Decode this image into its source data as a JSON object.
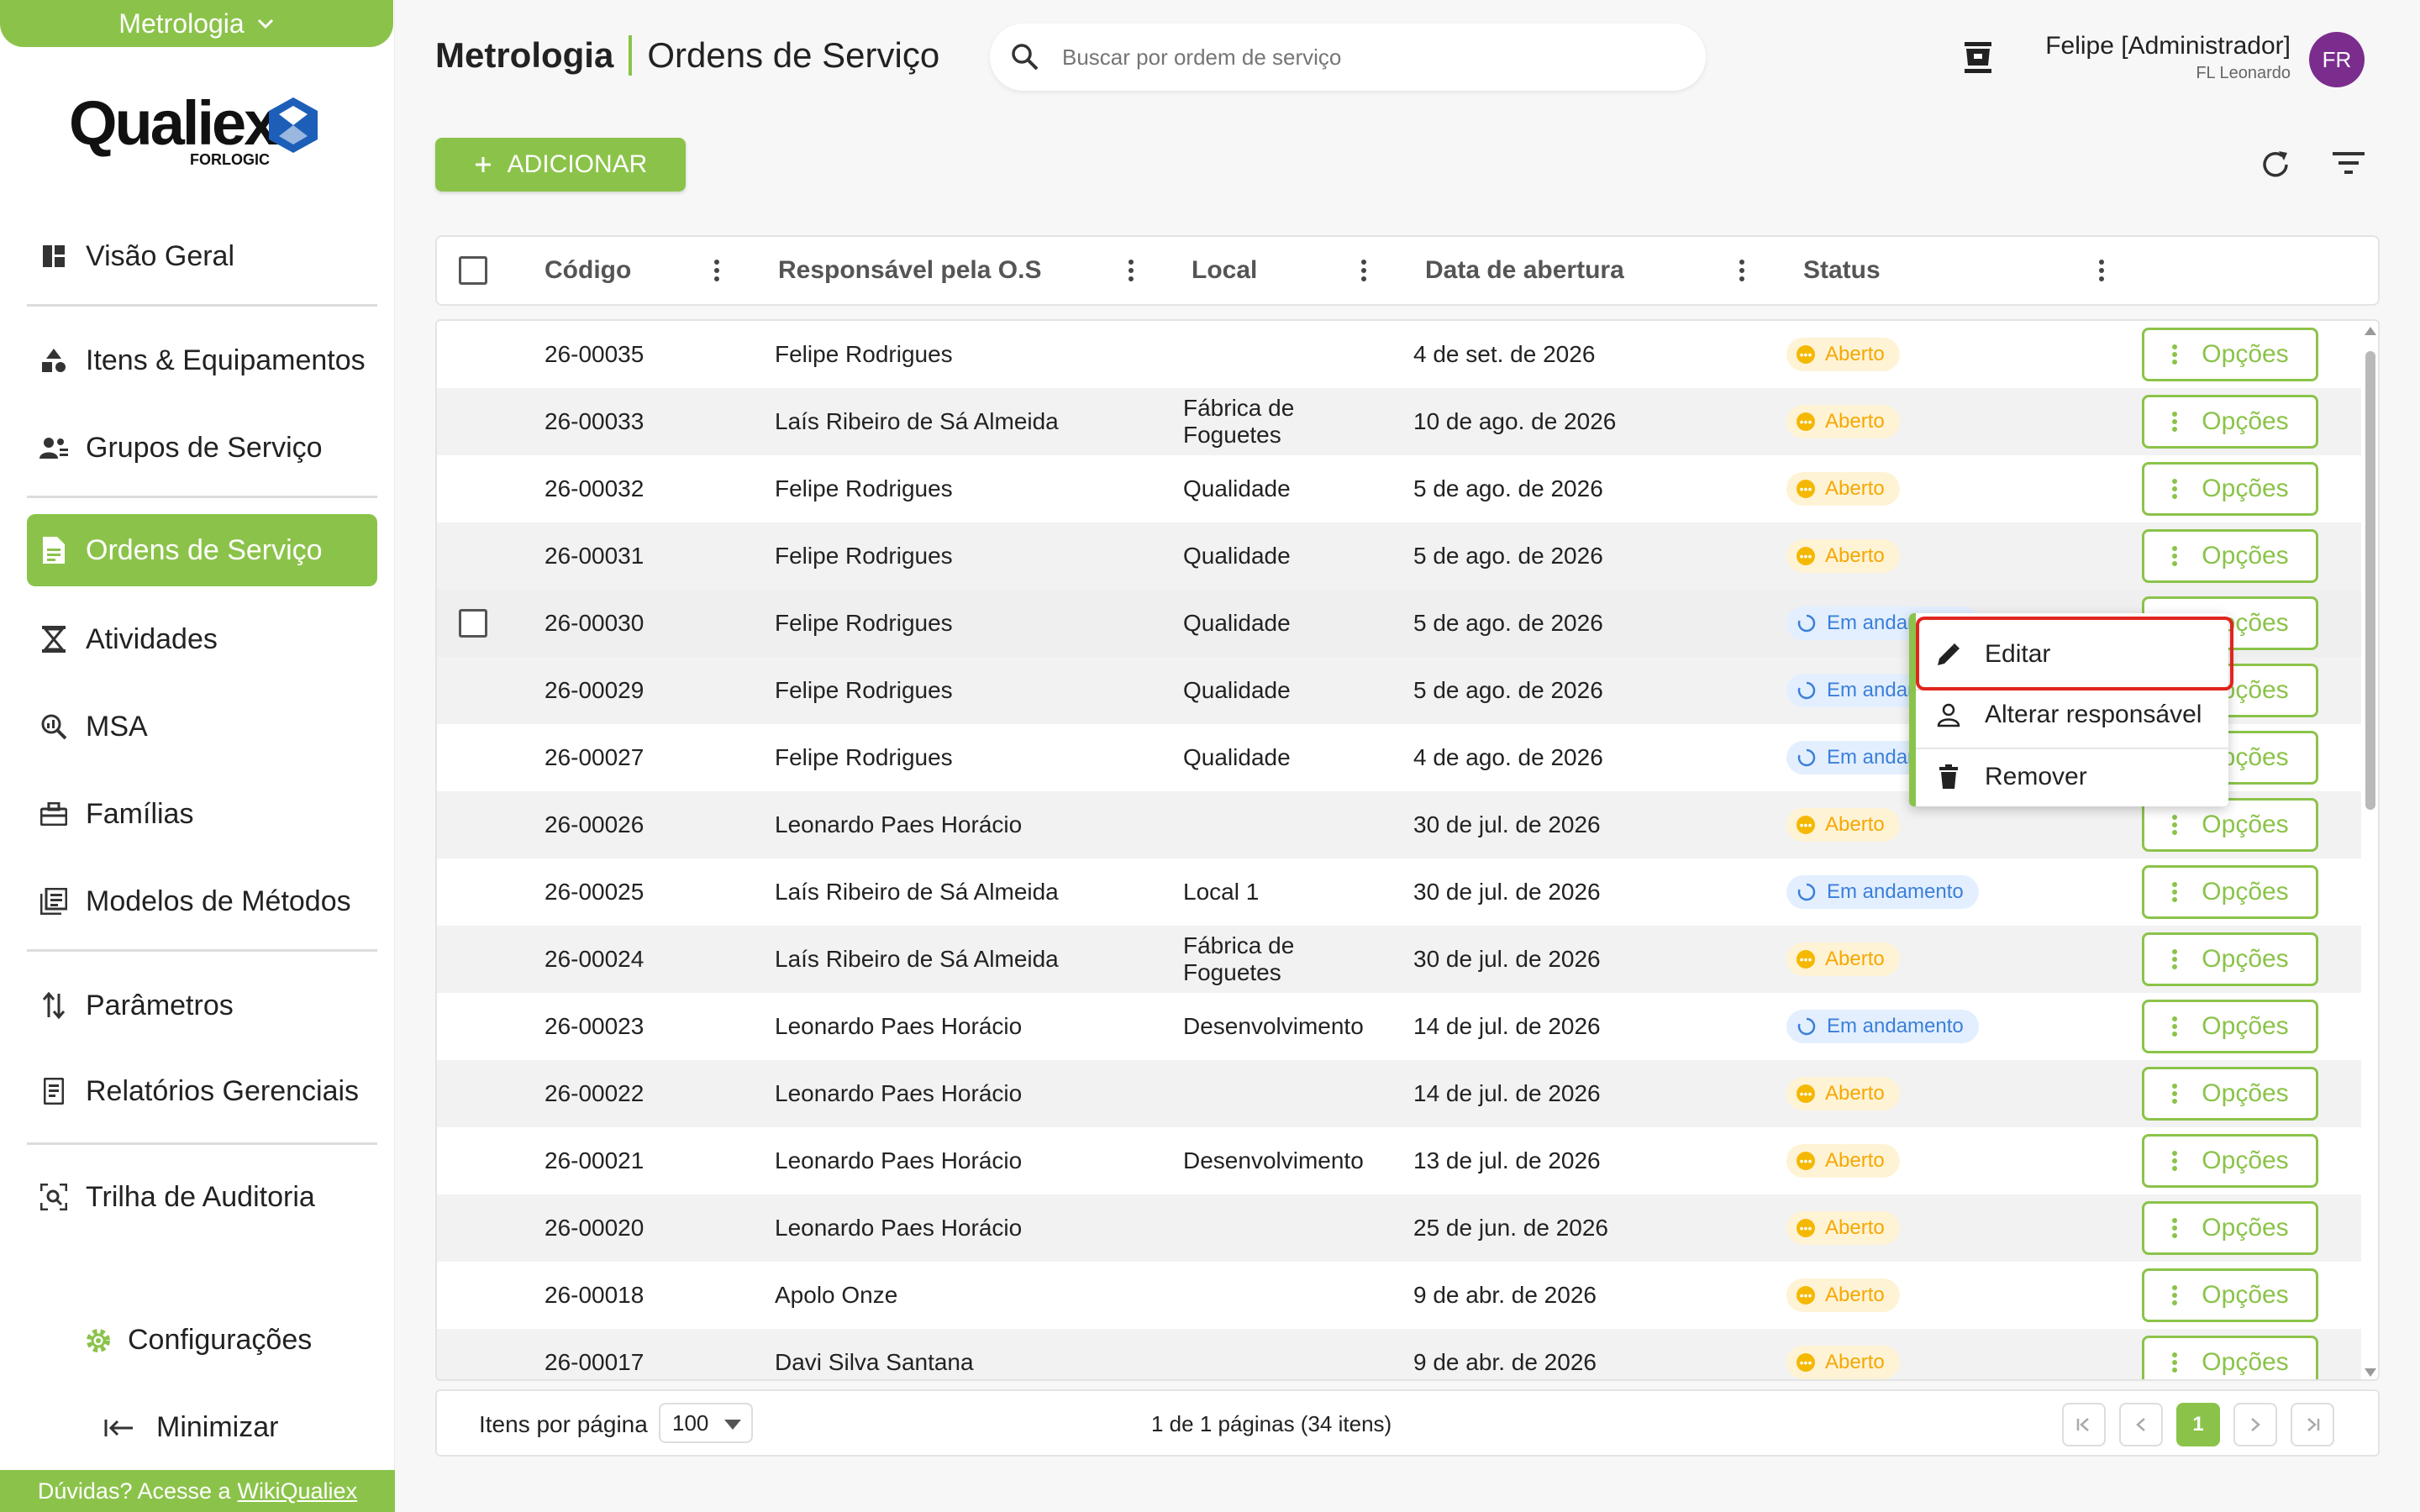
{
  "module": {
    "label": "Metrologia"
  },
  "logo": {
    "name": "Qualiex",
    "sub": "FORLOGIC"
  },
  "nav": [
    {
      "label": "Visão Geral",
      "icon": "dashboard-icon"
    },
    {
      "label": "Itens & Equipamentos",
      "icon": "shapes-icon"
    },
    {
      "label": "Grupos de Serviço",
      "icon": "group-icon"
    },
    {
      "label": "Ordens de Serviço",
      "icon": "document-icon"
    },
    {
      "label": "Atividades",
      "icon": "hourglass-icon"
    },
    {
      "label": "MSA",
      "icon": "magnifier-icon"
    },
    {
      "label": "Famílias",
      "icon": "toolbox-icon"
    },
    {
      "label": "Modelos de Métodos",
      "icon": "library-icon"
    },
    {
      "label": "Parâmetros",
      "icon": "sort-arrows-icon"
    },
    {
      "label": "Relatórios Gerenciais",
      "icon": "report-icon"
    },
    {
      "label": "Trilha de Auditoria",
      "icon": "audit-icon"
    }
  ],
  "settings": {
    "label": "Configurações"
  },
  "minimize": {
    "label": "Minimizar"
  },
  "help": {
    "text": "Dúvidas? Acesse a",
    "link": "WikiQualiex"
  },
  "header": {
    "app": "Metrologia",
    "page": "Ordens de Serviço"
  },
  "search": {
    "placeholder": "Buscar por ordem de serviço"
  },
  "user": {
    "name": "Felipe [Administrador]",
    "role": "FL Leonardo",
    "initials": "FR"
  },
  "toolbar": {
    "add_label": "ADICIONAR"
  },
  "table": {
    "columns": [
      "Código",
      "Responsável pela O.S",
      "Local",
      "Data de abertura",
      "Status"
    ],
    "option_label": "Opções",
    "rows": [
      {
        "code": "26-00035",
        "resp": "Felipe Rodrigues",
        "local": "",
        "date": "4 de set. de 2026",
        "status": "Aberto"
      },
      {
        "code": "26-00033",
        "resp": "Laís Ribeiro de Sá Almeida",
        "local": "Fábrica de Foguetes",
        "date": "10 de ago. de 2026",
        "status": "Aberto"
      },
      {
        "code": "26-00032",
        "resp": "Felipe Rodrigues",
        "local": "Qualidade",
        "date": "5 de ago. de 2026",
        "status": "Aberto"
      },
      {
        "code": "26-00031",
        "resp": "Felipe Rodrigues",
        "local": "Qualidade",
        "date": "5 de ago. de 2026",
        "status": "Aberto"
      },
      {
        "code": "26-00030",
        "resp": "Felipe Rodrigues",
        "local": "Qualidade",
        "date": "5 de ago. de 2026",
        "status": "Em andamento"
      },
      {
        "code": "26-00029",
        "resp": "Felipe Rodrigues",
        "local": "Qualidade",
        "date": "5 de ago. de 2026",
        "status": "Em andamento"
      },
      {
        "code": "26-00027",
        "resp": "Felipe Rodrigues",
        "local": "Qualidade",
        "date": "4 de ago. de 2026",
        "status": "Em andamento"
      },
      {
        "code": "26-00026",
        "resp": "Leonardo Paes Horácio",
        "local": "",
        "date": "30 de jul. de 2026",
        "status": "Aberto"
      },
      {
        "code": "26-00025",
        "resp": "Laís Ribeiro de Sá Almeida",
        "local": "Local 1",
        "date": "30 de jul. de 2026",
        "status": "Em andamento"
      },
      {
        "code": "26-00024",
        "resp": "Laís Ribeiro de Sá Almeida",
        "local": "Fábrica de Foguetes",
        "date": "30 de jul. de 2026",
        "status": "Aberto"
      },
      {
        "code": "26-00023",
        "resp": "Leonardo Paes Horácio",
        "local": "Desenvolvimento",
        "date": "14 de jul. de 2026",
        "status": "Em andamento"
      },
      {
        "code": "26-00022",
        "resp": "Leonardo Paes Horácio",
        "local": "",
        "date": "14 de jul. de 2026",
        "status": "Aberto"
      },
      {
        "code": "26-00021",
        "resp": "Leonardo Paes Horácio",
        "local": "Desenvolvimento",
        "date": "13 de jul. de 2026",
        "status": "Aberto"
      },
      {
        "code": "26-00020",
        "resp": "Leonardo Paes Horácio",
        "local": "",
        "date": "25 de jun. de 2026",
        "status": "Aberto"
      },
      {
        "code": "26-00018",
        "resp": "Apolo Onze",
        "local": "",
        "date": "9 de abr. de 2026",
        "status": "Aberto"
      },
      {
        "code": "26-00017",
        "resp": "Davi Silva Santana",
        "local": "",
        "date": "9 de abr. de 2026",
        "status": "Aberto"
      }
    ]
  },
  "context_menu": {
    "items": [
      {
        "label": "Editar",
        "icon": "pencil-icon"
      },
      {
        "label": "Alterar responsável",
        "icon": "person-icon"
      },
      {
        "label": "Remover",
        "icon": "trash-icon"
      }
    ]
  },
  "pagination": {
    "items_per_page_label": "Itens por página",
    "page_size": "100",
    "summary": "1 de 1 páginas (34 itens)",
    "current_page": "1"
  },
  "colors": {
    "accent": "#8bc34a",
    "open": "#f5a800",
    "progress": "#3b7fd9",
    "highlight": "#e0251e"
  }
}
